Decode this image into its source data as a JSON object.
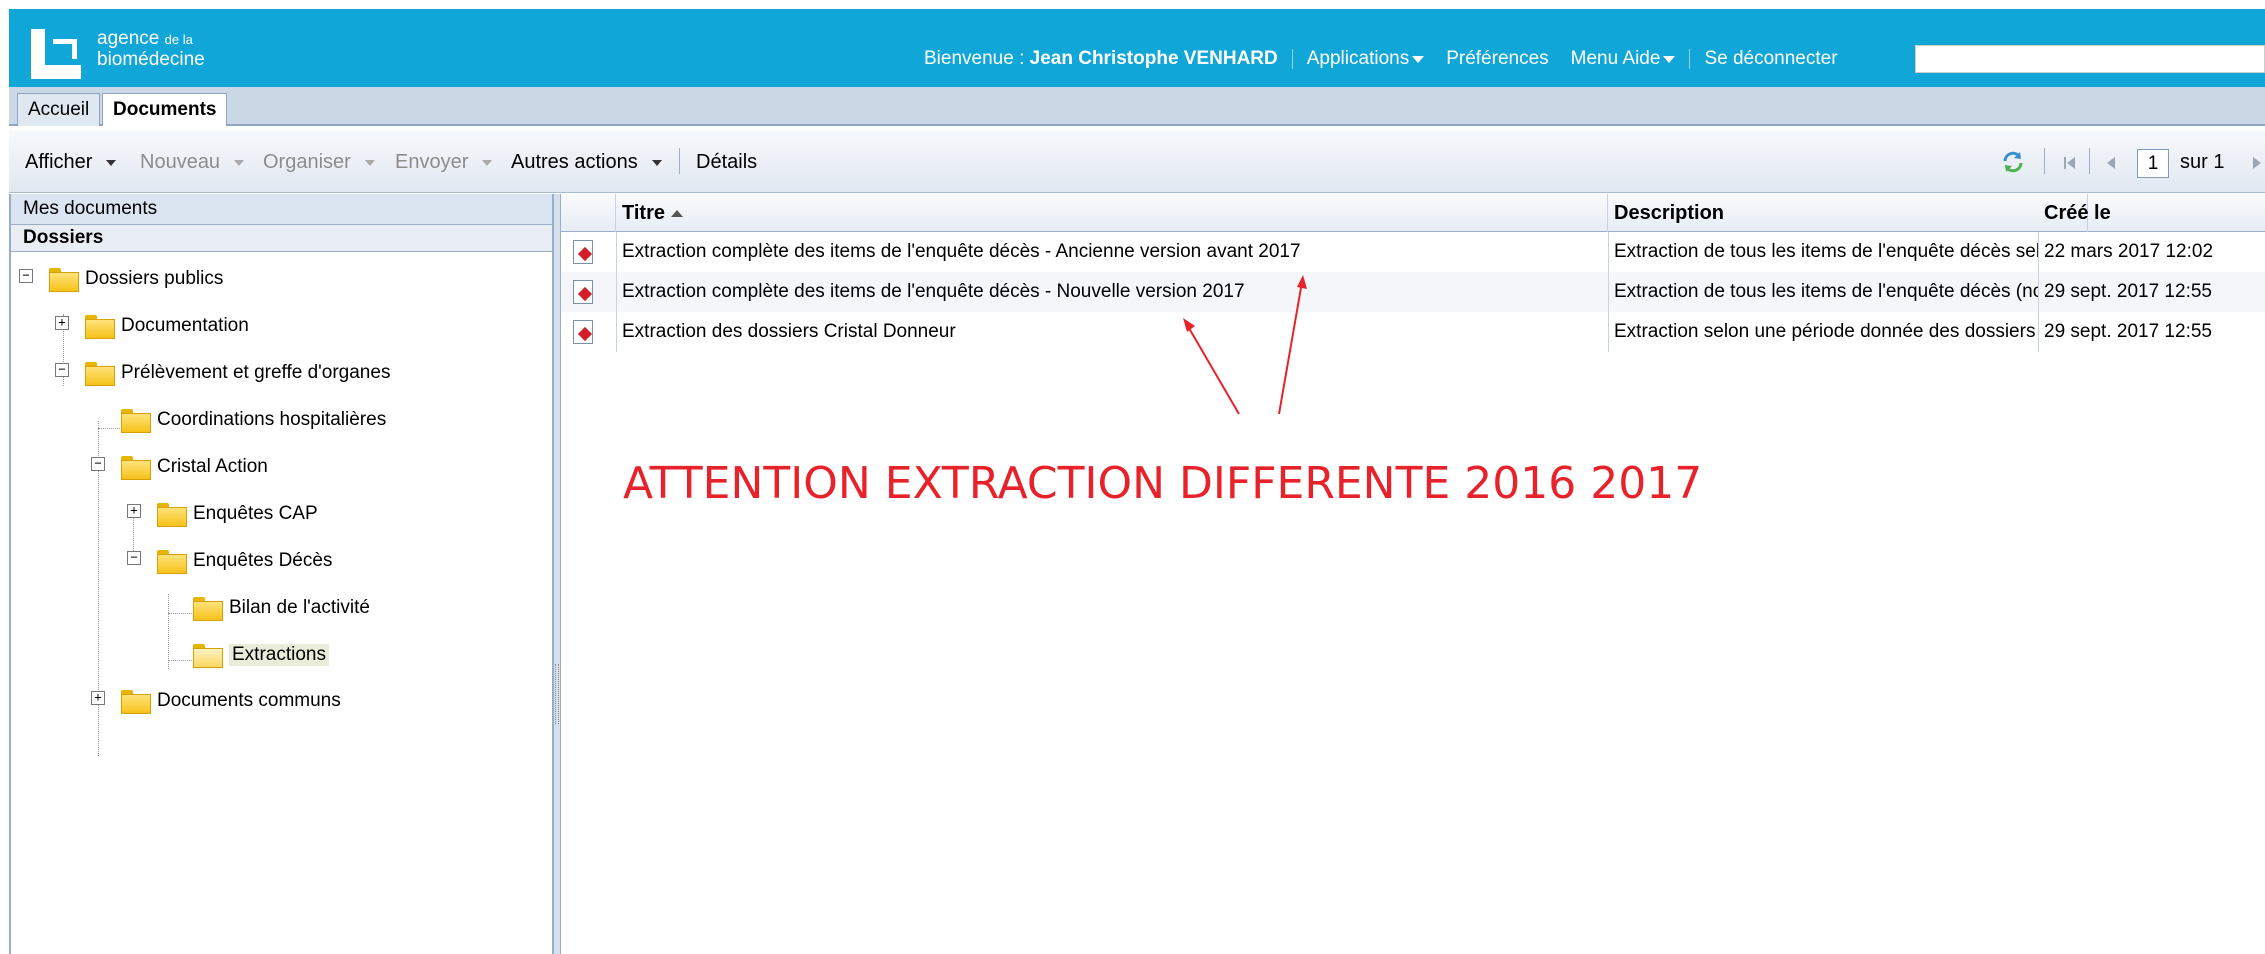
{
  "header": {
    "logo_line1": "agence",
    "logo_line1_small": "de la",
    "logo_line2": "biomédecine",
    "welcome_prefix": "Bienvenue :",
    "user_name": "Jean Christophe VENHARD",
    "menu_applications": "Applications",
    "menu_preferences": "Préférences",
    "menu_help": "Menu Aide",
    "logout": "Se déconnecter",
    "colors": {
      "bar": "#11a6d8",
      "text": "#ffffff"
    }
  },
  "tabs": [
    {
      "label": "Accueil",
      "active": false
    },
    {
      "label": "Documents",
      "active": true
    }
  ],
  "toolbar": {
    "afficher": "Afficher",
    "nouveau": "Nouveau",
    "organiser": "Organiser",
    "envoyer": "Envoyer",
    "autres_actions": "Autres actions",
    "details": "Détails",
    "page_current": "1",
    "page_of": "sur 1"
  },
  "sidebar": {
    "title": "Mes documents",
    "subtitle": "Dossiers",
    "tree": [
      {
        "label": "Dossiers publics"
      },
      {
        "label": "Documentation"
      },
      {
        "label": "Prélèvement et greffe d'organes"
      },
      {
        "label": "Coordinations hospitalières"
      },
      {
        "label": "Cristal Action"
      },
      {
        "label": "Enquêtes CAP"
      },
      {
        "label": "Enquêtes Décès"
      },
      {
        "label": "Bilan de l'activité"
      },
      {
        "label": "Extractions",
        "selected": true
      },
      {
        "label": "Documents communs"
      }
    ]
  },
  "grid": {
    "columns": [
      "Titre",
      "Description",
      "Créé le"
    ],
    "rows": [
      {
        "title": "Extraction complète des items de l'enquête décès - Ancienne version avant 2017",
        "description": "Extraction de tous les items de l'enquête décès selon u",
        "created": "22 mars 2017 12:02"
      },
      {
        "title": "Extraction complète des items de l'enquête décès - Nouvelle version 2017",
        "description": "Extraction de tous les items de l'enquête décès (nouve",
        "created": "29 sept. 2017 12:55"
      },
      {
        "title": "Extraction des dossiers Cristal Donneur",
        "description": "Extraction selon une période donnée des dossiers copi",
        "created": "29 sept. 2017 12:55"
      }
    ]
  },
  "annotation": {
    "text": "ATTENTION EXTRACTION DIFFERENTE 2016 2017",
    "color": "#e8222a"
  }
}
